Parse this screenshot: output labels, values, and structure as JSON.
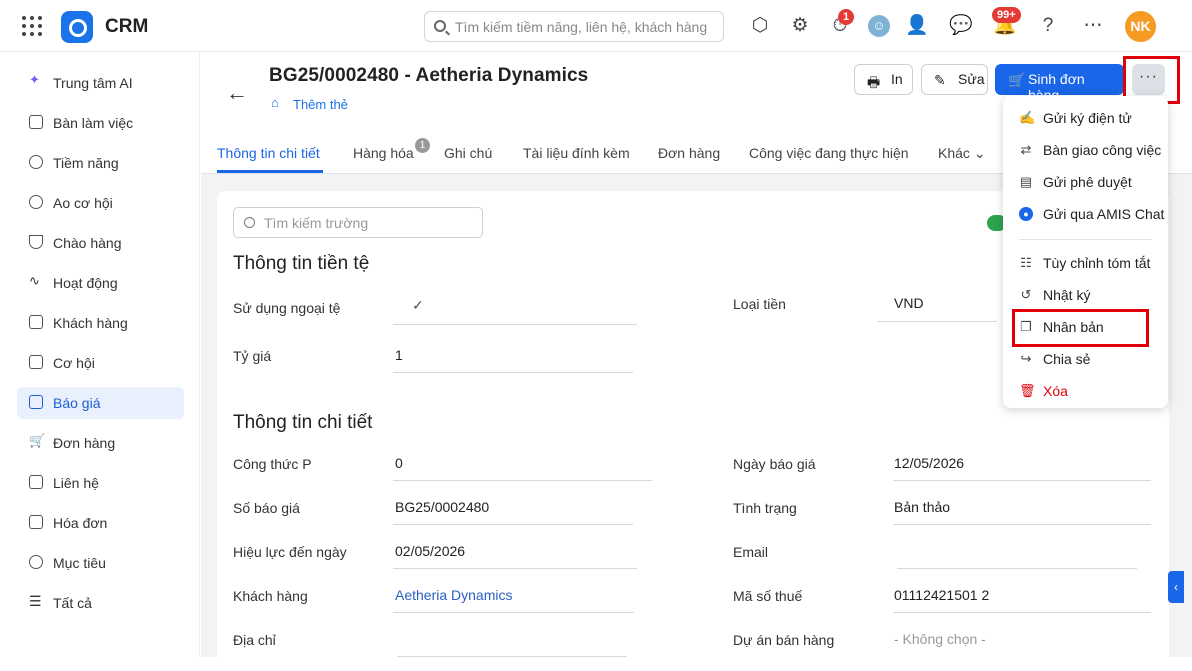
{
  "app": {
    "name": "CRM"
  },
  "topbar": {
    "search_placeholder": "Tìm kiếm tiềm năng, liên hệ, khách hàng",
    "timer_badge": "1",
    "notif_badge": "99+",
    "avatar_initials": "NK"
  },
  "sidebar": {
    "items": [
      {
        "label": "Trung tâm AI"
      },
      {
        "label": "Bàn làm việc"
      },
      {
        "label": "Tiềm năng"
      },
      {
        "label": "Ao cơ hội"
      },
      {
        "label": "Chào hàng"
      },
      {
        "label": "Hoạt động"
      },
      {
        "label": "Khách hàng"
      },
      {
        "label": "Cơ hội"
      },
      {
        "label": "Báo giá"
      },
      {
        "label": "Đơn hàng"
      },
      {
        "label": "Liên hệ"
      },
      {
        "label": "Hóa đơn"
      },
      {
        "label": "Mục tiêu"
      },
      {
        "label": "Tất cả"
      }
    ]
  },
  "header": {
    "title": "BG25/0002480 - Aetheria Dynamics",
    "add_tag": "Thêm thẻ",
    "print_label": "In",
    "edit_label": "Sửa",
    "create_order_label": "Sinh đơn hàng",
    "more_label": "···"
  },
  "tabs": [
    {
      "label": "Thông tin chi tiết"
    },
    {
      "label": "Hàng hóa"
    },
    {
      "label": "Ghi chú"
    },
    {
      "label": "Tài liệu đính kèm"
    },
    {
      "label": "Đơn hàng"
    },
    {
      "label": "Công việc đang thực hiện"
    },
    {
      "label": "Khác"
    }
  ],
  "tab_goods_badge": "1",
  "form": {
    "field_search_placeholder": "Tìm kiếm trường",
    "currency_section": "Thông tin tiền tệ",
    "detail_section": "Thông tin chi tiết",
    "use_foreign_currency": {
      "label": "Sử dụng ngoại tệ",
      "value": "✓"
    },
    "currency": {
      "label": "Loại tiền",
      "value": "VND"
    },
    "rate": {
      "label": "Tỷ giá",
      "value": "1"
    },
    "formula": {
      "label": "Công thức P",
      "value": "0"
    },
    "quote_date": {
      "label": "Ngày báo giá",
      "value": "12/05/2026"
    },
    "quote_no": {
      "label": "Số báo giá",
      "value": "BG25/0002480"
    },
    "status": {
      "label": "Tình trạng",
      "value": "Bản thảo"
    },
    "valid_until": {
      "label": "Hiệu lực đến ngày",
      "value": "02/05/2026"
    },
    "email": {
      "label": "Email",
      "value": ""
    },
    "customer": {
      "label": "Khách hàng",
      "value": "Aetheria Dynamics"
    },
    "tax_code": {
      "label": "Mã số thuế",
      "value": "01112421501 2"
    },
    "address": {
      "label": "Địa chỉ",
      "value": ""
    },
    "project": {
      "label": "Dự án bán hàng",
      "value": "- Không chọn -"
    }
  },
  "menu": {
    "items": [
      {
        "label": "Gửi ký điện tử"
      },
      {
        "label": "Bàn giao công việc"
      },
      {
        "label": "Gửi phê duyệt"
      },
      {
        "label": "Gửi qua AMIS Chat"
      },
      {
        "label": "Tùy chỉnh tóm tắt"
      },
      {
        "label": "Nhật ký"
      },
      {
        "label": "Nhân bản"
      },
      {
        "label": "Chia sẻ"
      },
      {
        "label": "Xóa"
      }
    ]
  },
  "colors": {
    "accent": "#1a66e8",
    "highlight": "#e0000a",
    "danger": "#e0000a"
  }
}
